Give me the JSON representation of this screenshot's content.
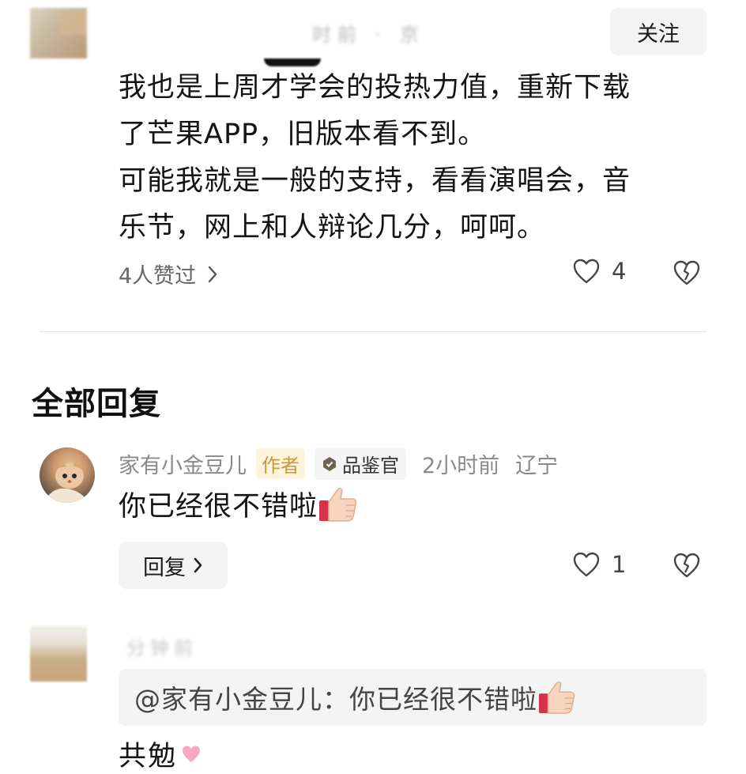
{
  "top_comment": {
    "meta_blurred": "时前 · 京",
    "follow_label": "关注",
    "lines": [
      "我也是上周才学会的投热力值，重新下载",
      "了芒果APP，旧版本看不到。",
      "可能我就是一般的支持，看看演唱会，音",
      "乐节，网上和人辩论几分，呵呵。"
    ],
    "likes_link": "4人赞过",
    "like_count": "4"
  },
  "section_title": "全部回复",
  "reply": {
    "username": "家有小金豆儿",
    "tag_author": "作者",
    "tag_judge": "品鉴官",
    "time": "2小时前",
    "location": "辽宁",
    "text": "你已经很不错啦",
    "reply_label": "回复",
    "like_count": "1"
  },
  "second_reply": {
    "meta_blurred": "分钟前",
    "quote": "@家有小金豆儿：你已经很不错啦",
    "text_cut": "共勉"
  },
  "icons": {
    "heart": "heart-outline-icon",
    "dislike": "broken-heart-icon",
    "chevron": "chevron-right-icon",
    "thumbs_up": "thumbs-up-emoji",
    "judge_badge": "diamond-badge-icon",
    "heart_emoji": "heart-ribbon-emoji"
  },
  "colors": {
    "meta_gray": "#8a8a8a",
    "author_tag_bg": "#fff3dc",
    "author_tag_text": "#c79b3b",
    "button_bg": "#f4f4f4"
  }
}
